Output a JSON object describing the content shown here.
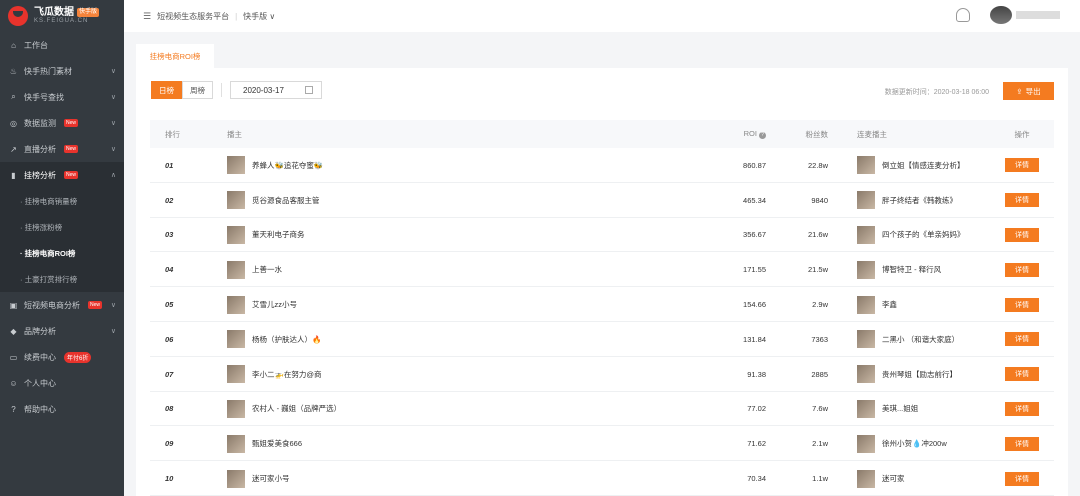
{
  "sidebar": {
    "logo_title": "飞瓜数据",
    "logo_badge": "快手版",
    "logo_sub": "KS.FEIGUA.CN",
    "items": [
      {
        "label": "工作台"
      },
      {
        "label": "快手热门素材"
      },
      {
        "label": "快手号查找"
      },
      {
        "label": "数据监测",
        "badge": "New"
      },
      {
        "label": "直播分析",
        "badge": "New"
      },
      {
        "label": "挂榜分析",
        "badge": "New"
      },
      {
        "label": "短视频电商分析",
        "badge": "New"
      },
      {
        "label": "品牌分析"
      },
      {
        "label": "续费中心",
        "badge": "年付6折"
      },
      {
        "label": "个人中心"
      },
      {
        "label": "帮助中心"
      }
    ],
    "subitems": [
      {
        "label": "· 挂榜电商销量榜"
      },
      {
        "label": "· 挂榜涨粉榜"
      },
      {
        "label": "· 挂榜电商ROI榜"
      },
      {
        "label": "· 土豪打赏排行榜"
      }
    ]
  },
  "topbar": {
    "crumb1": "短视频生态服务平台",
    "crumb2": "快手版 ∨"
  },
  "tab": {
    "label": "挂榜电商ROI榜"
  },
  "toolbar": {
    "day": "日榜",
    "week": "周榜",
    "date": "2020-03-17",
    "update": "数据更新时间：2020-03-18 06:00",
    "export": "导出"
  },
  "table": {
    "headers": {
      "rank": "排行",
      "host": "播主",
      "roi": "ROI",
      "fans": "粉丝数",
      "link": "连麦播主",
      "op": "操作"
    },
    "detail_label": "详情",
    "rows": [
      {
        "rank": "01",
        "host": "养蜂人🐝追花夺蜜🐝",
        "roi": "860.87",
        "fans": "22.8w",
        "link": "倒立姐【情感连麦分析】"
      },
      {
        "rank": "02",
        "host": "觅谷源食品客服主管",
        "roi": "465.34",
        "fans": "9840",
        "link": "胖子终结者《韩教练》"
      },
      {
        "rank": "03",
        "host": "董天利电子商务",
        "roi": "356.67",
        "fans": "21.6w",
        "link": "四个孩子的《单亲妈妈》"
      },
      {
        "rank": "04",
        "host": "上善一水",
        "roi": "171.55",
        "fans": "21.5w",
        "link": "博智特卫 - 释行风"
      },
      {
        "rank": "05",
        "host": "艾雪儿zz小号",
        "roi": "154.66",
        "fans": "2.9w",
        "link": "李鑫"
      },
      {
        "rank": "06",
        "host": "杨杨（护肤达人）🔥",
        "roi": "131.84",
        "fans": "7363",
        "link": "二黑小 （和谐大家庭）"
      },
      {
        "rank": "07",
        "host": "李小二🚁在努力@商",
        "roi": "91.38",
        "fans": "2885",
        "link": "贵州琴姐【励志前行】"
      },
      {
        "rank": "08",
        "host": "农村人 - 巍姐（品牌严选）",
        "roi": "77.02",
        "fans": "7.6w",
        "link": "美琪...姐姐"
      },
      {
        "rank": "09",
        "host": "甄姐爱美食666",
        "roi": "71.62",
        "fans": "2.1w",
        "link": "徐州小贺💧冲200w"
      },
      {
        "rank": "10",
        "host": "迷可家小号",
        "roi": "70.34",
        "fans": "1.1w",
        "link": "迷可家"
      }
    ]
  }
}
